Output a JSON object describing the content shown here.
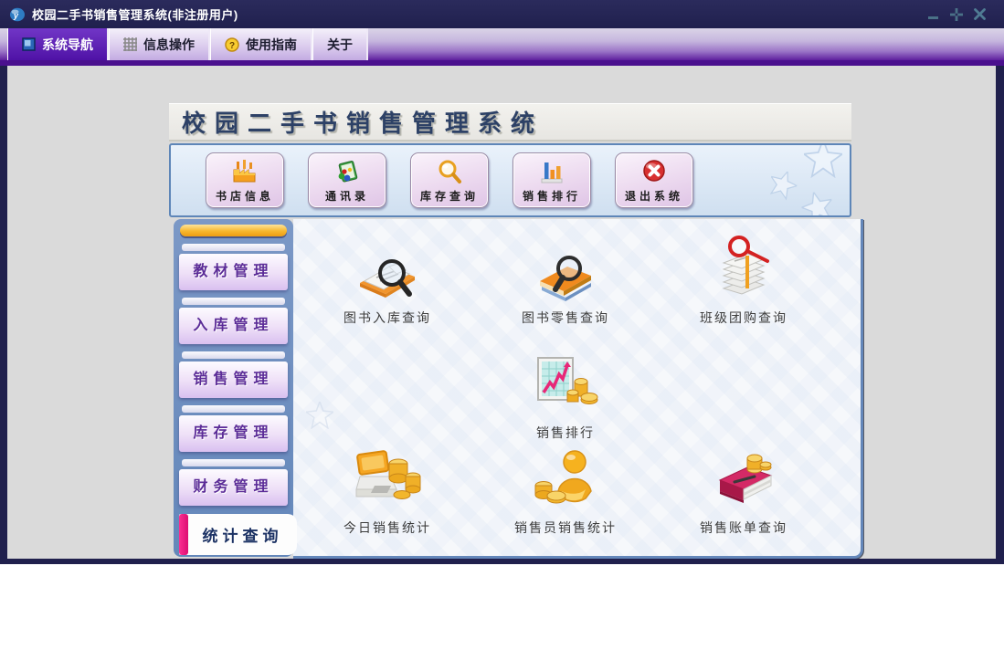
{
  "window": {
    "title": "校园二手书销售管理系统(非注册用户)"
  },
  "tabs": {
    "items": [
      {
        "label": "系统导航",
        "active": true
      },
      {
        "label": "信息操作",
        "active": false
      },
      {
        "label": "使用指南",
        "active": false
      },
      {
        "label": "关于",
        "active": false
      }
    ]
  },
  "banner": {
    "title": "校园二手书销售管理系统"
  },
  "toolbar": {
    "buttons": [
      {
        "label": "书店信息",
        "icon": "bookstore-factory-icon"
      },
      {
        "label": "通讯录",
        "icon": "address-book-icon"
      },
      {
        "label": "库存查询",
        "icon": "magnifier-icon"
      },
      {
        "label": "销售排行",
        "icon": "bar-chart-icon"
      },
      {
        "label": "退出系统",
        "icon": "exit-red-x-icon"
      }
    ]
  },
  "sidebar": {
    "items": [
      {
        "label": "教材管理"
      },
      {
        "label": "入库管理"
      },
      {
        "label": "销售管理"
      },
      {
        "label": "库存管理"
      },
      {
        "label": "财务管理"
      }
    ],
    "active": {
      "label": "统计查询"
    }
  },
  "content": {
    "items": [
      {
        "label": "图书入库查询",
        "icon": "document-search-icon"
      },
      {
        "label": "图书零售查询",
        "icon": "book-search-icon"
      },
      {
        "label": "班级团购查询",
        "icon": "paper-stack-search-icon"
      },
      {
        "label": "销售排行",
        "icon": "chart-coins-icon"
      },
      {
        "label": "今日销售统计",
        "icon": "cash-register-coins-icon"
      },
      {
        "label": "销售员销售统计",
        "icon": "salesperson-coins-icon"
      },
      {
        "label": "销售账单查询",
        "icon": "ledger-coins-icon"
      }
    ]
  },
  "colors": {
    "titlebar_navy": "#252553",
    "active_tab_purple": "#5a17ae",
    "tab_strip_purple": "#4a108e",
    "main_gray": "#dadada",
    "steel_blue": "#6487ba",
    "magenta_indicator": "#e8137e",
    "orange_bar": "#f7b72e",
    "toolbar_button_lavender": "#ecd9ef"
  }
}
